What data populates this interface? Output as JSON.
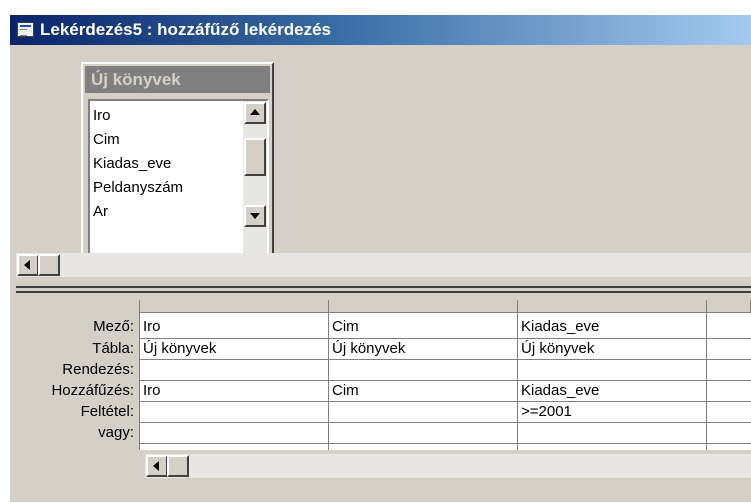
{
  "window": {
    "title": "Lekérdezés5 : hozzáfűző lekérdezés"
  },
  "table": {
    "name": "Új könyvek",
    "fields": [
      "Iro",
      "Cim",
      "Kiadas_eve",
      "Peldanyszám",
      "Ar"
    ]
  },
  "grid": {
    "row_labels": [
      "Mező:",
      "Tábla:",
      "Rendezés:",
      "Hozzáfűzés:",
      "Feltétel:",
      "vagy:"
    ],
    "columns": [
      {
        "field": "Iro",
        "table": "Új könyvek",
        "sort": "",
        "append": "Iro",
        "criteria": "",
        "or": ""
      },
      {
        "field": "Cim",
        "table": "Új könyvek",
        "sort": "",
        "append": "Cim",
        "criteria": "",
        "or": ""
      },
      {
        "field": "Kiadas_eve",
        "table": "Új könyvek",
        "sort": "",
        "append": "Kiadas_eve",
        "criteria": ">=2001",
        "or": ""
      }
    ]
  }
}
